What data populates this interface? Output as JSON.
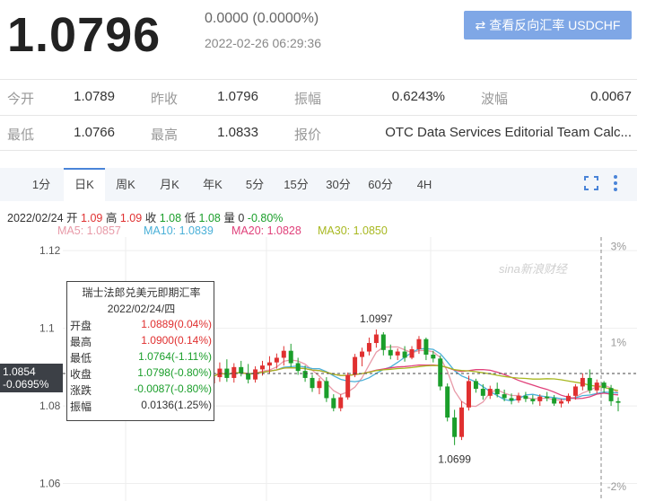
{
  "header": {
    "price": "1.0796",
    "change": "0.0000 (0.0000%)",
    "time": "2022-02-26 06:29:36",
    "reverse_btn": "查看反向汇率 USDCHF"
  },
  "quote": {
    "rows": [
      [
        {
          "label": "今开",
          "value": "1.0789"
        },
        {
          "label": "昨收",
          "value": "1.0796"
        },
        {
          "label": "振幅",
          "value": "0.6243%"
        },
        {
          "label": "波幅",
          "value": "0.0067"
        }
      ],
      [
        {
          "label": "最低",
          "value": "1.0766"
        },
        {
          "label": "最高",
          "value": "1.0833"
        },
        {
          "label": "报价",
          "value": "OTC Data Services Editorial Team Calc..."
        }
      ]
    ]
  },
  "tabs": [
    "1分",
    "日K",
    "周K",
    "月K",
    "年K",
    "5分",
    "15分",
    "30分",
    "60分",
    "4H"
  ],
  "active_tab": "日K",
  "ohlc": {
    "date": "2022/02/24",
    "open_lbl": "开",
    "open": "1.09",
    "high_lbl": "高",
    "high": "1.09",
    "close_lbl": "收",
    "close": "1.08",
    "low_lbl": "低",
    "low": "1.08",
    "vol_lbl": "量",
    "vol": "0",
    "chg": "-0.80%"
  },
  "ma": [
    {
      "label": "MA5: 1.0857",
      "color": "#e89aa8"
    },
    {
      "label": "MA10: 1.0839",
      "color": "#4ab0d8"
    },
    {
      "label": "MA20: 1.0828",
      "color": "#e0407a"
    },
    {
      "label": "MA30: 1.0850",
      "color": "#a8b820"
    }
  ],
  "tooltip": {
    "title": "瑞士法郎兑美元即期汇率",
    "date": "2022/02/24/四",
    "rows": [
      {
        "label": "开盘",
        "value": "1.0889(0.04%)",
        "color": "red"
      },
      {
        "label": "最高",
        "value": "1.0900(0.14%)",
        "color": "red"
      },
      {
        "label": "最低",
        "value": "1.0764(-1.11%)",
        "color": "green"
      },
      {
        "label": "收盘",
        "value": "1.0798(-0.80%)",
        "color": "green"
      },
      {
        "label": "涨跌",
        "value": "-0.0087(-0.80%)",
        "color": "green"
      },
      {
        "label": "振幅",
        "value": "0.0136(1.25%)",
        "color": "dark"
      }
    ]
  },
  "price_tag": {
    "price": "1.0854",
    "pct": "-0.0695%"
  },
  "watermark": "sina新浪财经",
  "chart_data": {
    "type": "candlestick",
    "y_ticks": [
      "1.12",
      "1.1",
      "1.08",
      "1.06"
    ],
    "y_tick_values": [
      1.12,
      1.1,
      1.08,
      1.06
    ],
    "pct_ticks": [
      "3%",
      "1%",
      "-2%"
    ],
    "pct_tick_values": [
      3,
      1,
      -2
    ],
    "ylim": [
      1.0555,
      1.1235
    ],
    "pct_lim": [
      -2.3,
      3.2
    ],
    "annotations": [
      {
        "text": "1.0997",
        "index": 23,
        "value": 1.0997
      },
      {
        "text": "1.0699",
        "index": 34,
        "value": 1.0699
      }
    ],
    "candles": [
      {
        "o": 1.0858,
        "h": 1.0882,
        "l": 1.0846,
        "c": 1.0874
      },
      {
        "o": 1.0874,
        "h": 1.0912,
        "l": 1.0862,
        "c": 1.0896
      },
      {
        "o": 1.0896,
        "h": 1.092,
        "l": 1.0862,
        "c": 1.0872
      },
      {
        "o": 1.0872,
        "h": 1.091,
        "l": 1.086,
        "c": 1.09
      },
      {
        "o": 1.09,
        "h": 1.0916,
        "l": 1.0876,
        "c": 1.0884
      },
      {
        "o": 1.0884,
        "h": 1.0908,
        "l": 1.0858,
        "c": 1.0868
      },
      {
        "o": 1.0868,
        "h": 1.0902,
        "l": 1.086,
        "c": 1.0894
      },
      {
        "o": 1.0894,
        "h": 1.0916,
        "l": 1.0878,
        "c": 1.0904
      },
      {
        "o": 1.0904,
        "h": 1.0928,
        "l": 1.0884,
        "c": 1.0912
      },
      {
        "o": 1.0912,
        "h": 1.0935,
        "l": 1.0896,
        "c": 1.0924
      },
      {
        "o": 1.0924,
        "h": 1.0954,
        "l": 1.0904,
        "c": 1.0942
      },
      {
        "o": 1.0942,
        "h": 1.096,
        "l": 1.09,
        "c": 1.091
      },
      {
        "o": 1.091,
        "h": 1.0924,
        "l": 1.088,
        "c": 1.089
      },
      {
        "o": 1.089,
        "h": 1.0904,
        "l": 1.0862,
        "c": 1.0872
      },
      {
        "o": 1.0872,
        "h": 1.088,
        "l": 1.0836,
        "c": 1.0846
      },
      {
        "o": 1.0846,
        "h": 1.0872,
        "l": 1.083,
        "c": 1.0864
      },
      {
        "o": 1.0864,
        "h": 1.0874,
        "l": 1.081,
        "c": 1.082
      },
      {
        "o": 1.082,
        "h": 1.083,
        "l": 1.0786,
        "c": 1.0794
      },
      {
        "o": 1.0794,
        "h": 1.083,
        "l": 1.0786,
        "c": 1.0822
      },
      {
        "o": 1.0822,
        "h": 1.0886,
        "l": 1.0816,
        "c": 1.088
      },
      {
        "o": 1.088,
        "h": 1.0934,
        "l": 1.0874,
        "c": 1.0926
      },
      {
        "o": 1.0926,
        "h": 1.095,
        "l": 1.0902,
        "c": 1.094
      },
      {
        "o": 1.094,
        "h": 1.0976,
        "l": 1.093,
        "c": 1.0962
      },
      {
        "o": 1.0962,
        "h": 1.0997,
        "l": 1.095,
        "c": 1.0984
      },
      {
        "o": 1.0984,
        "h": 1.099,
        "l": 1.093,
        "c": 1.0944
      },
      {
        "o": 1.0944,
        "h": 1.0958,
        "l": 1.092,
        "c": 1.093
      },
      {
        "o": 1.093,
        "h": 1.0948,
        "l": 1.0918,
        "c": 1.094
      },
      {
        "o": 1.094,
        "h": 1.0954,
        "l": 1.0914,
        "c": 1.0924
      },
      {
        "o": 1.0924,
        "h": 1.0954,
        "l": 1.092,
        "c": 1.0946
      },
      {
        "o": 1.0946,
        "h": 1.098,
        "l": 1.0934,
        "c": 1.0972
      },
      {
        "o": 1.0972,
        "h": 1.0976,
        "l": 1.0918,
        "c": 1.0932
      },
      {
        "o": 1.0932,
        "h": 1.0942,
        "l": 1.0912,
        "c": 1.0922
      },
      {
        "o": 1.0922,
        "h": 1.093,
        "l": 1.084,
        "c": 1.085
      },
      {
        "o": 1.085,
        "h": 1.0858,
        "l": 1.076,
        "c": 1.077
      },
      {
        "o": 1.077,
        "h": 1.079,
        "l": 1.0699,
        "c": 1.072
      },
      {
        "o": 1.072,
        "h": 1.0812,
        "l": 1.0712,
        "c": 1.0796
      },
      {
        "o": 1.0796,
        "h": 1.0878,
        "l": 1.0788,
        "c": 1.0864
      },
      {
        "o": 1.0864,
        "h": 1.087,
        "l": 1.0834,
        "c": 1.0844
      },
      {
        "o": 1.0844,
        "h": 1.0856,
        "l": 1.0816,
        "c": 1.0826
      },
      {
        "o": 1.0826,
        "h": 1.0852,
        "l": 1.0818,
        "c": 1.0844
      },
      {
        "o": 1.0844,
        "h": 1.086,
        "l": 1.0822,
        "c": 1.083
      },
      {
        "o": 1.083,
        "h": 1.0842,
        "l": 1.0812,
        "c": 1.082
      },
      {
        "o": 1.082,
        "h": 1.0832,
        "l": 1.0804,
        "c": 1.0814
      },
      {
        "o": 1.0814,
        "h": 1.0834,
        "l": 1.0808,
        "c": 1.0826
      },
      {
        "o": 1.0826,
        "h": 1.0836,
        "l": 1.081,
        "c": 1.0818
      },
      {
        "o": 1.0818,
        "h": 1.0828,
        "l": 1.0804,
        "c": 1.0812
      },
      {
        "o": 1.0812,
        "h": 1.083,
        "l": 1.08,
        "c": 1.0824
      },
      {
        "o": 1.0824,
        "h": 1.0836,
        "l": 1.0812,
        "c": 1.082
      },
      {
        "o": 1.082,
        "h": 1.0828,
        "l": 1.08,
        "c": 1.0806
      },
      {
        "o": 1.0806,
        "h": 1.0818,
        "l": 1.0796,
        "c": 1.0812
      },
      {
        "o": 1.0812,
        "h": 1.0832,
        "l": 1.0806,
        "c": 1.0826
      },
      {
        "o": 1.0826,
        "h": 1.0856,
        "l": 1.0816,
        "c": 1.085
      },
      {
        "o": 1.085,
        "h": 1.0884,
        "l": 1.084,
        "c": 1.0872
      },
      {
        "o": 1.0872,
        "h": 1.0894,
        "l": 1.0832,
        "c": 1.084
      },
      {
        "o": 1.084,
        "h": 1.0868,
        "l": 1.0832,
        "c": 1.086
      },
      {
        "o": 1.086,
        "h": 1.0864,
        "l": 1.0834,
        "c": 1.0846
      },
      {
        "o": 1.0846,
        "h": 1.0854,
        "l": 1.08,
        "c": 1.0812
      },
      {
        "o": 1.0812,
        "h": 1.0822,
        "l": 1.0786,
        "c": 1.0808
      }
    ]
  }
}
